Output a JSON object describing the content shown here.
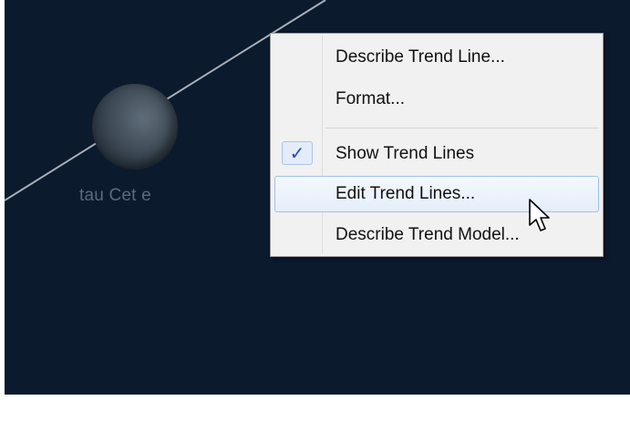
{
  "point": {
    "label": "tau Cet e"
  },
  "context_menu": {
    "items": [
      {
        "label": "Describe Trend Line...",
        "checked": false
      },
      {
        "label": "Format...",
        "checked": false
      },
      {
        "label": "Show Trend Lines",
        "checked": true
      },
      {
        "label": "Edit Trend Lines...",
        "checked": false,
        "hovered": true
      },
      {
        "label": "Describe Trend Model...",
        "checked": false
      }
    ],
    "check_glyph": "✓"
  },
  "colors": {
    "background": "#0c1a2e",
    "menu_background": "#f1f1f1",
    "hover_border": "#9fc1ea",
    "check_color": "#1f4fb0"
  },
  "icons": {
    "cursor": "mouse-pointer-icon",
    "check": "checkmark-icon"
  }
}
